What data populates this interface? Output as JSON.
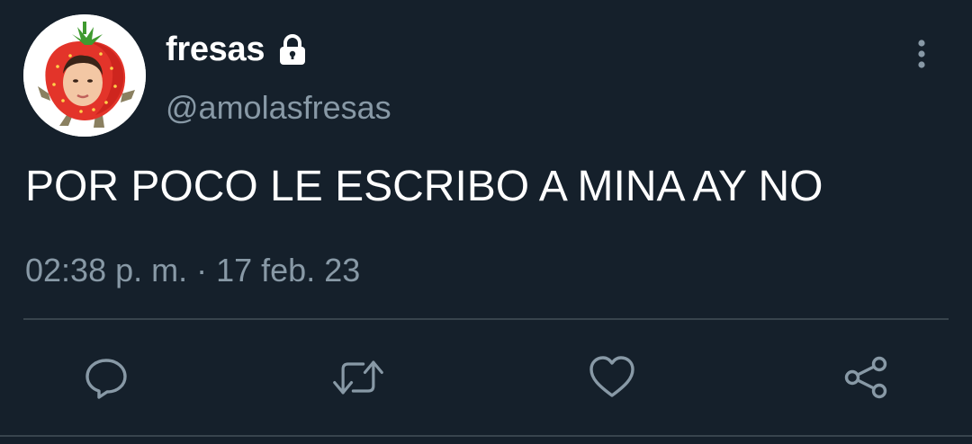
{
  "user": {
    "display_name": "fresas",
    "handle": "@amolasfresas",
    "protected_icon": "lock-icon",
    "avatar_icon": "strawberry-costume-avatar"
  },
  "tweet": {
    "text": "POR POCO LE ESCRIBO A MINA AY NO",
    "timestamp": "02:38 p. m. · 17 feb. 23"
  },
  "actions": [
    {
      "icon": "reply-icon"
    },
    {
      "icon": "retweet-icon"
    },
    {
      "icon": "like-icon"
    },
    {
      "icon": "share-icon"
    }
  ],
  "menu_icon": "more-vertical-icon",
  "colors": {
    "background": "#15202b",
    "primary_text": "#ffffff",
    "secondary_text": "#8899a6",
    "divider": "#38444d"
  }
}
